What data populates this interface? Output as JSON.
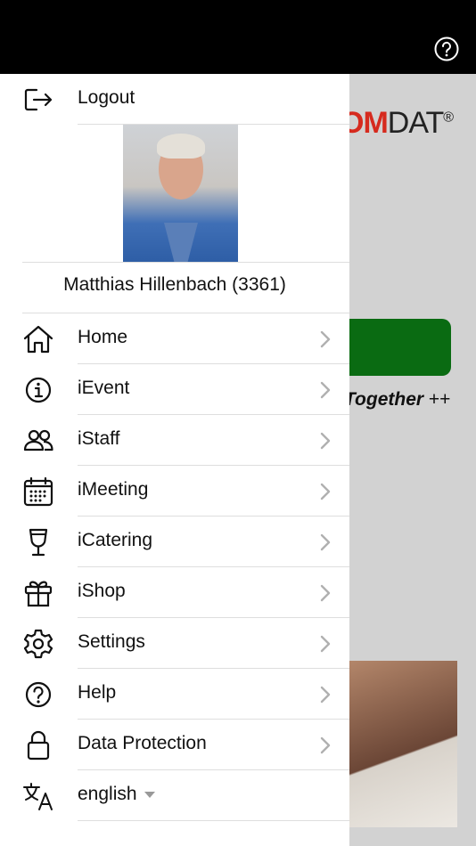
{
  "background": {
    "brand_prefix": "OM",
    "brand_suffix": "DAT",
    "brand_mark": "®",
    "tagline": "Together",
    "tagline_suffix": "++"
  },
  "drawer": {
    "logout_label": "Logout",
    "user_name": "Matthias Hillenbach (3361)",
    "menu_items": [
      {
        "label": "Home",
        "icon": "home-icon"
      },
      {
        "label": "iEvent",
        "icon": "info-icon"
      },
      {
        "label": "iStaff",
        "icon": "people-icon"
      },
      {
        "label": "iMeeting",
        "icon": "calendar-icon"
      },
      {
        "label": "iCatering",
        "icon": "wine-glass-icon"
      },
      {
        "label": "iShop",
        "icon": "gift-icon"
      },
      {
        "label": "Settings",
        "icon": "gear-icon"
      },
      {
        "label": "Help",
        "icon": "help-icon"
      },
      {
        "label": "Data Protection",
        "icon": "lock-icon"
      }
    ],
    "language": {
      "label": "english",
      "icon": "translate-icon"
    }
  },
  "colors": {
    "accent_green": "#0a6b12",
    "brand_red": "#d62a1e"
  }
}
